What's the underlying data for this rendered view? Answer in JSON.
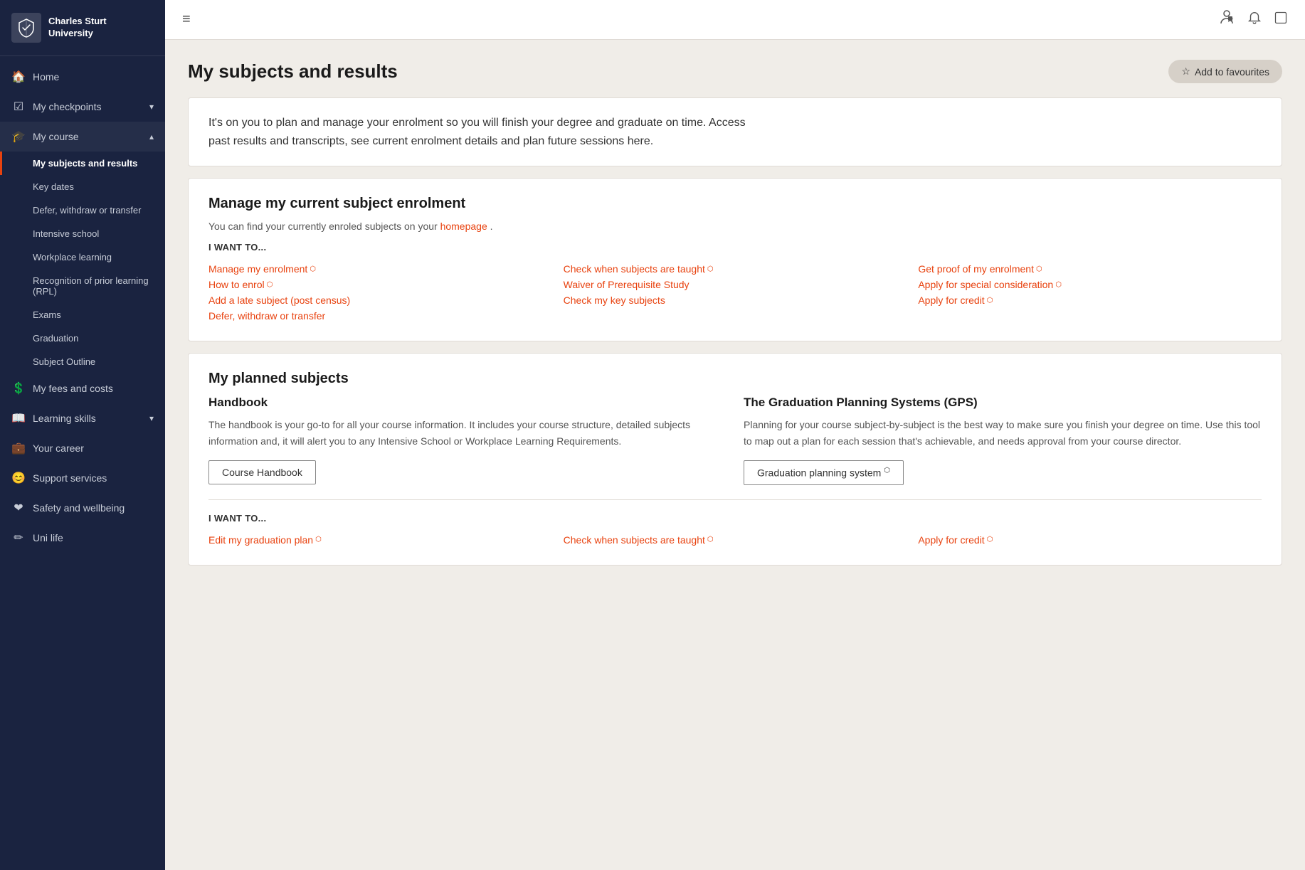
{
  "sidebar": {
    "logo_text": "Charles Sturt\nUniversity",
    "items": [
      {
        "id": "home",
        "label": "Home",
        "icon": "🏠",
        "active": false,
        "expandable": false
      },
      {
        "id": "my-checkpoints",
        "label": "My checkpoints",
        "icon": "☑",
        "active": false,
        "expandable": true
      },
      {
        "id": "my-course",
        "label": "My course",
        "icon": "🎓",
        "active": true,
        "expandable": true,
        "expanded": true
      }
    ],
    "sub_items": [
      {
        "id": "my-subjects",
        "label": "My subjects and results",
        "active": true
      },
      {
        "id": "key-dates",
        "label": "Key dates",
        "active": false
      },
      {
        "id": "defer-withdraw",
        "label": "Defer, withdraw or transfer",
        "active": false
      },
      {
        "id": "intensive-school",
        "label": "Intensive school",
        "active": false
      },
      {
        "id": "workplace-learning",
        "label": "Workplace learning",
        "active": false
      },
      {
        "id": "rpl",
        "label": "Recognition of prior learning (RPL)",
        "active": false
      },
      {
        "id": "exams",
        "label": "Exams",
        "active": false
      },
      {
        "id": "graduation",
        "label": "Graduation",
        "active": false
      },
      {
        "id": "subject-outline",
        "label": "Subject Outline",
        "active": false
      }
    ],
    "bottom_items": [
      {
        "id": "fees",
        "label": "My fees and costs",
        "icon": "$",
        "active": false
      },
      {
        "id": "learning-skills",
        "label": "Learning skills",
        "icon": "📖",
        "active": false,
        "expandable": true
      },
      {
        "id": "your-career",
        "label": "Your career",
        "icon": "💼",
        "active": false
      },
      {
        "id": "support-services",
        "label": "Support services",
        "icon": "😊",
        "active": false
      },
      {
        "id": "safety-wellbeing",
        "label": "Safety and wellbeing",
        "icon": "❤",
        "active": false
      },
      {
        "id": "uni-life",
        "label": "Uni life",
        "icon": "✏",
        "active": false
      }
    ]
  },
  "topbar": {
    "hamburger_icon": "≡",
    "profile_icon": "👤",
    "bell_icon": "🔔",
    "square_icon": "⬜"
  },
  "page": {
    "title": "My subjects and results",
    "add_favourites_label": "Add to favourites",
    "info_text_1": "It's on you to plan and manage your enrolment so you will finish your degree and graduate on time. Access",
    "info_text_2": "past results and transcripts, see current enrolment details and plan future sessions here.",
    "section1": {
      "title": "Manage my current subject enrolment",
      "subtitle": "You can find your currently enroled subjects on your",
      "subtitle_link": "homepage",
      "subtitle_end": ".",
      "i_want_label": "I WANT TO...",
      "links": [
        {
          "col": 0,
          "text": "Manage my enrolment",
          "external": true
        },
        {
          "col": 0,
          "text": "How to enrol",
          "external": true
        },
        {
          "col": 0,
          "text": "Add a late subject (post census)",
          "external": false
        },
        {
          "col": 0,
          "text": "Defer, withdraw or transfer",
          "external": false
        },
        {
          "col": 1,
          "text": "Check when subjects are taught",
          "external": true
        },
        {
          "col": 1,
          "text": "Waiver of Prerequisite Study",
          "external": false
        },
        {
          "col": 1,
          "text": "Check my key subjects",
          "external": false
        },
        {
          "col": 2,
          "text": "Get proof of my enrolment",
          "external": true
        },
        {
          "col": 2,
          "text": "Apply for special consideration",
          "external": true
        },
        {
          "col": 2,
          "text": "Apply for credit",
          "external": true
        }
      ]
    },
    "section2": {
      "title": "My planned subjects",
      "handbook": {
        "title": "Handbook",
        "desc": "The handbook is your go-to for all your course information. It includes your course structure, detailed subjects information and, it will alert you to any Intensive School or Workplace Learning Requirements.",
        "btn_label": "Course Handbook"
      },
      "gps": {
        "title": "The Graduation Planning Systems (GPS)",
        "desc": "Planning for your course subject-by-subject is the best way to make sure you finish your degree on time. Use this tool to map out a plan for each session that's achievable, and needs approval from your course director.",
        "btn_label": "Graduation planning system",
        "btn_external": true
      },
      "i_want_label": "I WANT TO...",
      "links": [
        {
          "col": 0,
          "text": "Edit my graduation plan",
          "external": true
        },
        {
          "col": 1,
          "text": "Check when subjects are taught",
          "external": true
        },
        {
          "col": 2,
          "text": "Apply for credit",
          "external": true
        }
      ]
    }
  }
}
